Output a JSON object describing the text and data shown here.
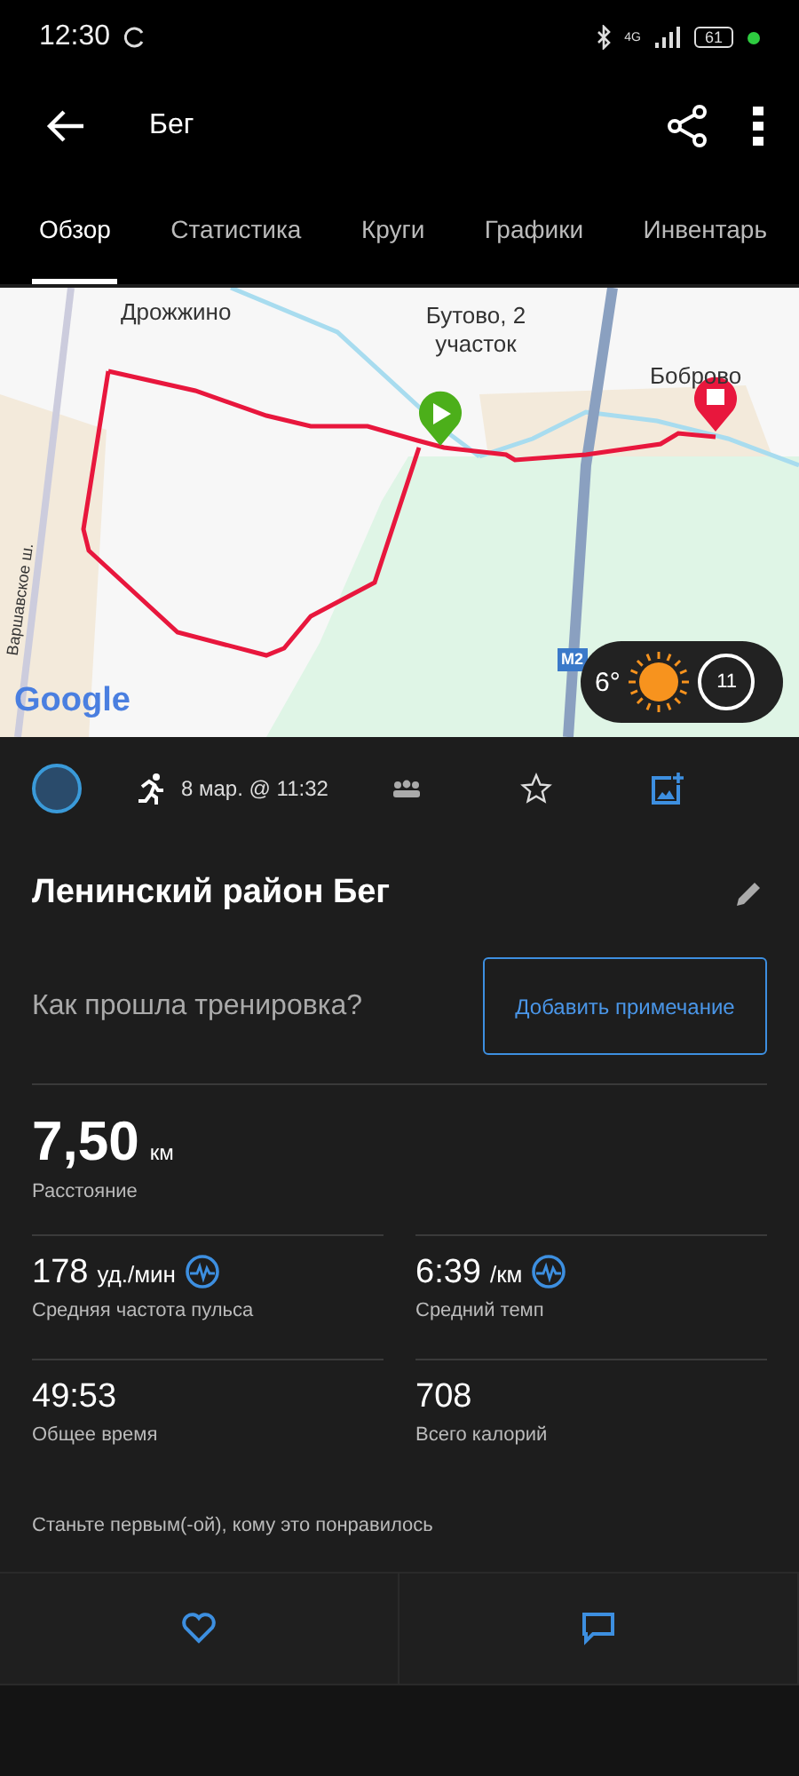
{
  "status_bar": {
    "time": "12:30",
    "network": "4G",
    "battery": "61"
  },
  "app_bar": {
    "title": "Бег"
  },
  "tabs": [
    {
      "label": "Обзор",
      "selected": true
    },
    {
      "label": "Статистика",
      "selected": false
    },
    {
      "label": "Круги",
      "selected": false
    },
    {
      "label": "Графики",
      "selected": false
    },
    {
      "label": "Инвентарь",
      "selected": false
    }
  ],
  "map": {
    "labels": [
      {
        "text": "Дрожжино",
        "kind": "place"
      },
      {
        "text": "Бутово, 2 участок",
        "kind": "place"
      },
      {
        "text": "Боброво",
        "kind": "place"
      },
      {
        "text": "Варшавское ш.",
        "kind": "road"
      },
      {
        "text": "M2",
        "kind": "shield"
      }
    ],
    "logo": "Google",
    "weather": {
      "temperature": "6°",
      "wind": "11"
    }
  },
  "activity_info": {
    "date": "8 мар. @ 11:32"
  },
  "title": "Ленинский район Бег",
  "note_prompt": "Как прошла тренировка?",
  "note_button": "Добавить примечание",
  "distance": {
    "value": "7,50",
    "unit": "км",
    "label": "Расстояние"
  },
  "stats": [
    {
      "value": "178",
      "unit": "уд./мин",
      "label": "Средняя частота пульса",
      "chart_link": true
    },
    {
      "value": "6:39",
      "unit": "/км",
      "label": "Средний темп",
      "chart_link": true
    },
    {
      "value": "49:53",
      "label": "Общее время",
      "chart_link": false
    },
    {
      "value": "708",
      "label": "Всего калорий",
      "chart_link": false
    }
  ],
  "likes_text": "Станьте первым(-ой), кому это понравилось"
}
